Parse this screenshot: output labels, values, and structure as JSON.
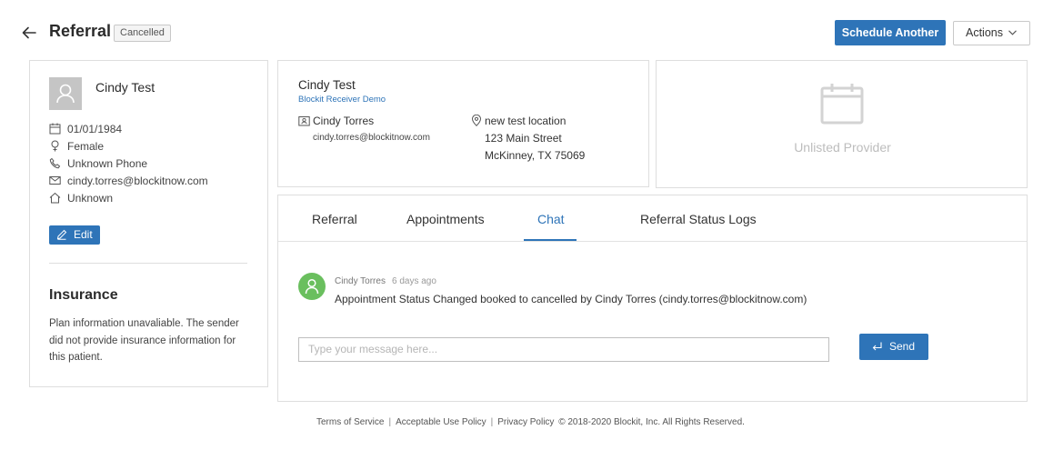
{
  "header": {
    "title": "Referral",
    "status": "Cancelled",
    "schedule_label": "Schedule Another",
    "actions_label": "Actions"
  },
  "patient": {
    "name": "Cindy Test",
    "dob": "01/01/1984",
    "gender": "Female",
    "phone": "Unknown Phone",
    "email": "cindy.torres@blockitnow.com",
    "address": "Unknown",
    "edit_label": "Edit",
    "insurance_title": "Insurance",
    "insurance_text": "Plan information unavaliable. The sender did not provide insurance information for this patient."
  },
  "referral": {
    "name": "Cindy Test",
    "org": "Blockit Receiver Demo",
    "contact_name": "Cindy Torres",
    "contact_email": "cindy.torres@blockitnow.com",
    "location_name": "new test location",
    "location_street": "123 Main Street",
    "location_city": "McKinney, TX 75069"
  },
  "provider": {
    "label": "Unlisted Provider"
  },
  "tabs": [
    {
      "label": "Referral"
    },
    {
      "label": "Appointments"
    },
    {
      "label": "Chat"
    },
    {
      "label": "Referral Status Logs"
    }
  ],
  "chat": {
    "messages": [
      {
        "author": "Cindy Torres",
        "time": "6 days ago",
        "text": "Appointment Status Changed booked to cancelled by Cindy Torres (cindy.torres@blockitnow.com)"
      }
    ],
    "placeholder": "Type your message here...",
    "send_label": "Send"
  },
  "footer": {
    "terms": "Terms of Service",
    "aup": "Acceptable Use Policy",
    "privacy": "Privacy Policy",
    "copyright": "© 2018-2020 Blockit, Inc. All Rights Reserved.",
    "separator": "|"
  },
  "colors": {
    "accent": "#2e74b8",
    "avatar_green": "#6abf5e"
  }
}
